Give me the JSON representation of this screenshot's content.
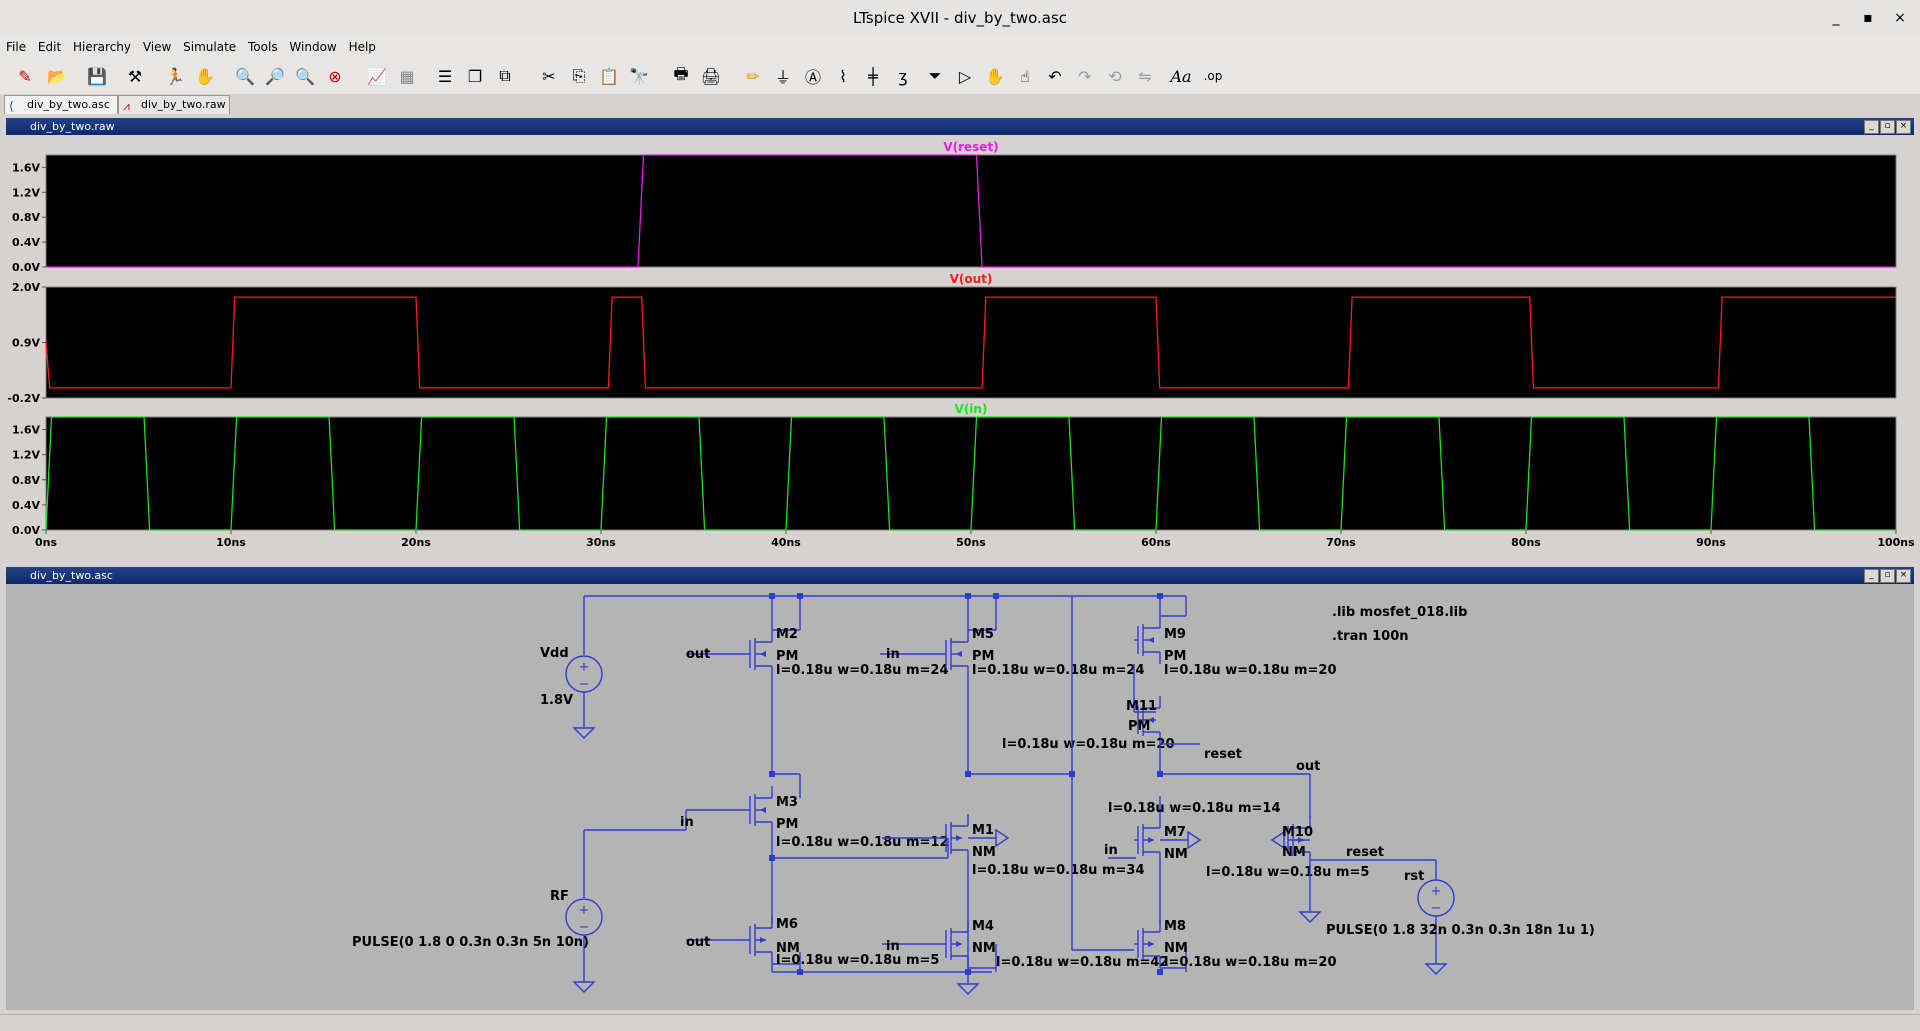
{
  "window": {
    "title": "LTspice XVII - div_by_two.asc",
    "minimize": "_",
    "maximize": "▪",
    "close": "×"
  },
  "menu": [
    "File",
    "Edit",
    "Hierarchy",
    "View",
    "Simulate",
    "Tools",
    "Window",
    "Help"
  ],
  "tabs": [
    {
      "label": "div_by_two.asc",
      "icon": "schematic-icon",
      "active": true
    },
    {
      "label": "div_by_two.raw",
      "icon": "waveform-icon",
      "active": false
    }
  ],
  "waveform_pane": {
    "title": "div_by_two.raw",
    "x_ticks": [
      "0ns",
      "10ns",
      "20ns",
      "30ns",
      "40ns",
      "50ns",
      "60ns",
      "70ns",
      "80ns",
      "90ns",
      "100ns"
    ],
    "plots": [
      {
        "name": "V(reset)",
        "color": "#e61ee6",
        "y_ticks": [
          "1.6V",
          "1.2V",
          "0.8V",
          "0.4V",
          "0.0V"
        ]
      },
      {
        "name": "V(out)",
        "color": "#ff1a1a",
        "y_ticks": [
          "2.0V",
          "0.9V",
          "-0.2V"
        ]
      },
      {
        "name": "V(in)",
        "color": "#19e619",
        "y_ticks": [
          "1.6V",
          "1.2V",
          "0.8V",
          "0.4V",
          "0.0V"
        ]
      }
    ]
  },
  "chart_data": [
    {
      "type": "line",
      "title": "V(reset)",
      "xlabel": "",
      "ylabel": "",
      "xlim": [
        0,
        100
      ],
      "ylim": [
        0,
        1.8
      ],
      "series": [
        {
          "name": "V(reset)",
          "x": [
            0,
            32,
            32.3,
            50.3,
            50.6,
            100
          ],
          "y": [
            0,
            0,
            1.8,
            1.8,
            0,
            0
          ]
        }
      ]
    },
    {
      "type": "line",
      "title": "V(out)",
      "xlabel": "",
      "ylabel": "",
      "xlim": [
        0,
        100
      ],
      "ylim": [
        -0.2,
        2.0
      ],
      "series": [
        {
          "name": "V(out)",
          "x": [
            0,
            0.2,
            10,
            10.2,
            20,
            20.2,
            30.4,
            30.6,
            32.2,
            32.4,
            50.6,
            50.8,
            60,
            60.2,
            70.4,
            70.6,
            80.2,
            80.4,
            90.4,
            90.6,
            100
          ],
          "y": [
            0.9,
            0,
            0,
            1.8,
            1.8,
            0,
            0,
            1.8,
            1.8,
            0,
            0,
            1.8,
            1.8,
            0,
            0,
            1.8,
            1.8,
            0,
            0,
            1.8,
            1.8
          ]
        }
      ]
    },
    {
      "type": "line",
      "title": "V(in)",
      "xlabel": "",
      "ylabel": "",
      "xlim": [
        0,
        100
      ],
      "ylim": [
        0,
        1.8
      ],
      "series": [
        {
          "name": "V(in)",
          "pulse": {
            "low": 0,
            "high": 1.8,
            "delay": 0,
            "rise": 0.3,
            "fall": 0.3,
            "width": 5,
            "period": 10
          }
        }
      ]
    }
  ],
  "schematic_pane": {
    "title": "div_by_two.asc",
    "directives": [
      ".lib mosfet_018.lib",
      ".tran 100n"
    ],
    "sources": [
      {
        "name": "Vdd",
        "value": "1.8V"
      },
      {
        "name": "RF",
        "value": "PULSE(0 1.8 0 0.3n 0.3n 5n 10n)"
      },
      {
        "name": "rst",
        "value": "PULSE(0 1.8 32n 0.3n 0.3n 18n 1u 1)"
      }
    ],
    "transistors": [
      {
        "ref": "M2",
        "model": "PM",
        "params": "l=0.18u w=0.18u m=24"
      },
      {
        "ref": "M5",
        "model": "PM",
        "params": "l=0.18u w=0.18u m=24"
      },
      {
        "ref": "M9",
        "model": "PM",
        "params": "l=0.18u w=0.18u m=20"
      },
      {
        "ref": "M11",
        "model": "PM",
        "params": "l=0.18u w=0.18u m=20"
      },
      {
        "ref": "M3",
        "model": "PM",
        "params": "l=0.18u w=0.18u m=12"
      },
      {
        "ref": "M1",
        "model": "NM",
        "params": "l=0.18u w=0.18u m=34"
      },
      {
        "ref": "M7",
        "model": "NM",
        "params": "l=0.18u w=0.18u m=14"
      },
      {
        "ref": "M10",
        "model": "NM",
        "params": "l=0.18u w=0.18u m=5"
      },
      {
        "ref": "M6",
        "model": "NM",
        "params": "l=0.18u w=0.18u m=5"
      },
      {
        "ref": "M4",
        "model": "NM",
        "params": "l=0.18u w=0.18u m=42"
      },
      {
        "ref": "M8",
        "model": "NM",
        "params": "l=0.18u w=0.18u m=20"
      }
    ],
    "net_labels": {
      "out": "out",
      "in": "in",
      "reset": "reset"
    }
  }
}
